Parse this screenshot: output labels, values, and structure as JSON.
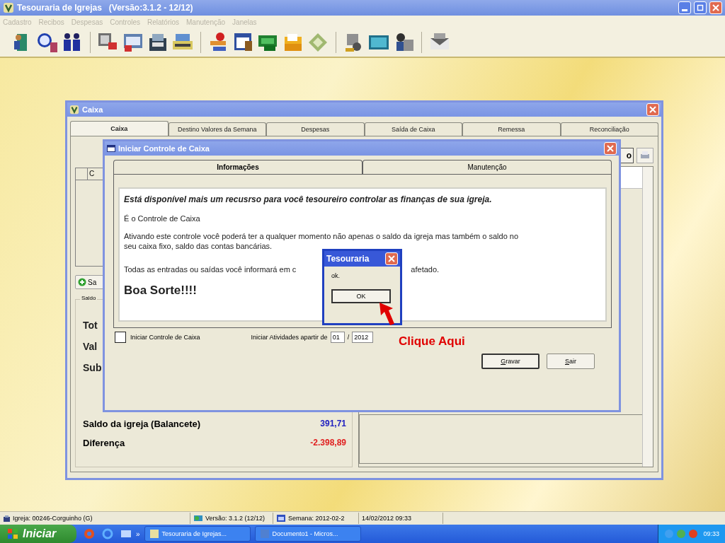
{
  "app": {
    "title": "Tesouraria de Igrejas   (Versão:3.1.2 - 12/12)"
  },
  "menu": [
    {
      "label": "Cadastro",
      "disabled": true
    },
    {
      "label": "Recibos",
      "disabled": true
    },
    {
      "label": "Despesas",
      "disabled": true
    },
    {
      "label": "Controles",
      "disabled": true
    },
    {
      "label": "Relatórios",
      "disabled": true
    },
    {
      "label": "Manutenção",
      "disabled": true
    },
    {
      "label": "Janelas",
      "disabled": true
    }
  ],
  "caixa_window": {
    "title": "Caixa",
    "tabs": [
      {
        "label": "Caixa",
        "selected": true
      },
      {
        "label": "Destino Valores da Semana",
        "selected": false
      },
      {
        "label": "Despesas",
        "selected": false
      },
      {
        "label": "Saída de Caixa",
        "selected": false
      },
      {
        "label": "Remessa",
        "selected": false
      },
      {
        "label": "Reconciliação",
        "selected": false
      }
    ],
    "grid_header_fragment": "C",
    "button_fragment": "Sa",
    "right_button_fragment": "o",
    "group_label": "Saldo",
    "label_fragments": [
      "Tot",
      "Val",
      "Sub"
    ],
    "saldo_igreja": {
      "label": "Saldo da igreja (Balancete)",
      "value": "391,71"
    },
    "diferenca": {
      "label": "Diferença",
      "value": "-2.398,89"
    }
  },
  "dialog": {
    "title": "Iniciar Controle de Caixa",
    "tabs": [
      {
        "label": "Informações",
        "selected": true
      },
      {
        "label": "Manutenção",
        "selected": false
      }
    ],
    "intro": "Está disponível mais um recusrso para você tesoureiro controlar as finanças de sua igreja.",
    "subtitle": "É o Controle de Caixa",
    "paragraph": "Ativando este controle você poderá ter a qualquer momento não apenas o saldo da igreja mas também o saldo no seu caixa fixo, saldo das contas bancárias.",
    "partial_left": "Todas as entradas ou saídas você informará em c",
    "partial_right": "afetado.",
    "closing": "Boa Sorte!!!!",
    "checkbox": {
      "label": "Iniciar Controle de Caixa",
      "checked": false
    },
    "start_label": "Iniciar Atividades apartir de",
    "month": "01",
    "separator": "/",
    "year": "2012",
    "buttons": [
      "Gravar",
      "Sair"
    ]
  },
  "message_box": {
    "title": "Tesouraria",
    "text": "ok.",
    "button": "OK"
  },
  "annotation": {
    "text": "Clique Aqui"
  },
  "status_bar": [
    "Igreja: 00246-Corguinho (G)",
    "Versão: 3.1.2 (12/12)",
    "Semana: 2012-02-2",
    "14/02/2012  09:33"
  ],
  "taskbar": {
    "start": "Iniciar",
    "overflow": "»",
    "tasks": [
      {
        "label": "Tesouraria de Igrejas...",
        "selected": false
      },
      {
        "label": "Documento1 - Micros...",
        "selected": false
      }
    ],
    "clock": "09:33"
  }
}
